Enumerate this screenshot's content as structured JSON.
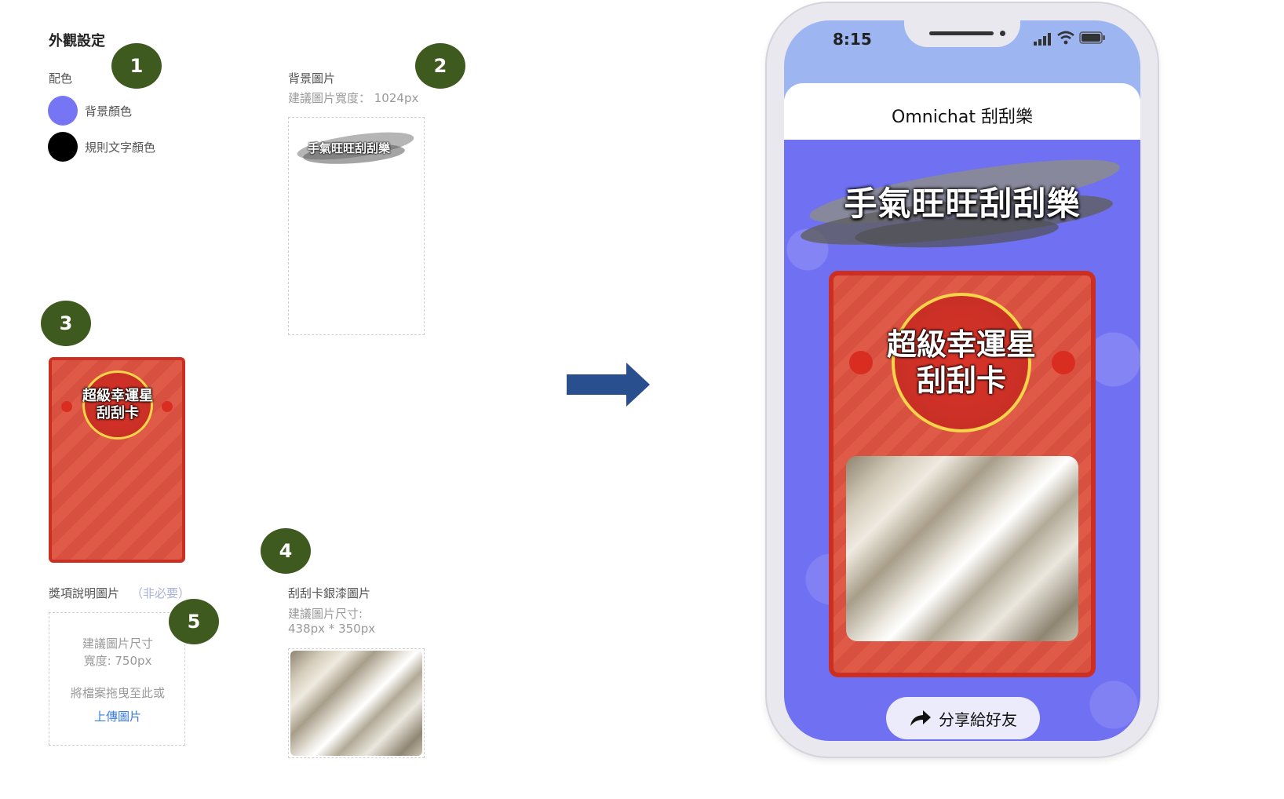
{
  "settings": {
    "title": "外觀設定",
    "colors_label": "配色",
    "bg_color_label": "背景顏色",
    "bg_color": "#7272f5",
    "rule_text_color_label": "規則文字顏色",
    "rule_text_color": "#000000"
  },
  "background_image": {
    "label": "背景圖片",
    "hint": "建議圖片寬度： 1024px",
    "title_text": "手氣旺旺刮刮樂"
  },
  "card": {
    "line1": "超級幸運星",
    "line2": "刮刮卡"
  },
  "prize_image": {
    "label": "獎項說明圖片",
    "optional": "（非必要）",
    "hint_line1": "建議圖片尺寸",
    "hint_line2": "寬度: 750px",
    "drag_text": "將檔案拖曳至此或",
    "upload_link": "上傳圖片"
  },
  "silver_image": {
    "label": "刮刮卡銀漆圖片",
    "hint_line1": "建議圖片尺寸:",
    "hint_line2": "438px * 350px"
  },
  "badges": [
    "1",
    "2",
    "3",
    "4",
    "5"
  ],
  "phone": {
    "time": "8:15",
    "header_title": "Omnichat 刮刮樂",
    "banner_text": "手氣旺旺刮刮樂",
    "share_button": "分享給好友",
    "status_bar_color": "#9fb6f2"
  }
}
